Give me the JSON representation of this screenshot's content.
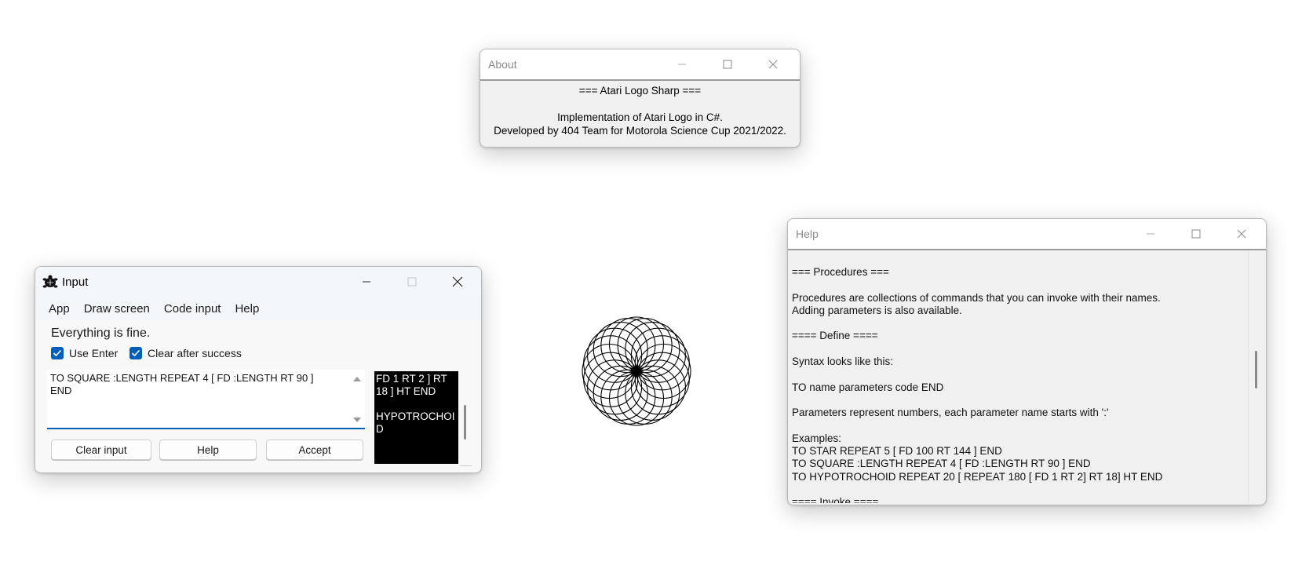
{
  "about": {
    "title": "About",
    "lines": [
      "=== Atari Logo Sharp ===",
      "",
      "Implementation of Atari Logo in C#.",
      "Developed by 404 Team for Motorola Science Cup 2021/2022."
    ]
  },
  "input_window": {
    "title": "Input",
    "menu": [
      "App",
      "Draw screen",
      "Code input",
      "Help"
    ],
    "status": "Everything is fine.",
    "checkboxes": [
      {
        "label": "Use Enter",
        "checked": true
      },
      {
        "label": "Clear after success",
        "checked": true
      }
    ],
    "code_text": "TO SQUARE :LENGTH REPEAT 4 [ FD :LENGTH RT 90 ]\nEND",
    "buttons": {
      "clear": "Clear input",
      "help": "Help",
      "accept": "Accept"
    },
    "history_text": "FD 1 RT 2 ] RT\n18 ] HT END\n\nHYPOTROCHOI\nD"
  },
  "help_window": {
    "title": "Help",
    "text": "=== Procedures ===\n\nProcedures are collections of commands that you can invoke with their names.\nAdding parameters is also available.\n\n==== Define ====\n\nSyntax looks like this:\n\nTO name parameters code END\n\nParameters represent numbers, each parameter name starts with ':'\n\nExamples:\nTO STAR REPEAT 5 [ FD 100 RT 144 ] END\nTO SQUARE :LENGTH REPEAT 4 [ FD :LENGTH RT 90 ] END\nTO HYPOTROCHOID REPEAT 20 [ REPEAT 180 [ FD 1 RT 2] RT 18] HT END\n\n==== Invoke ===="
  },
  "drawing": {
    "ring_count": 20,
    "turn_degrees": 18
  }
}
